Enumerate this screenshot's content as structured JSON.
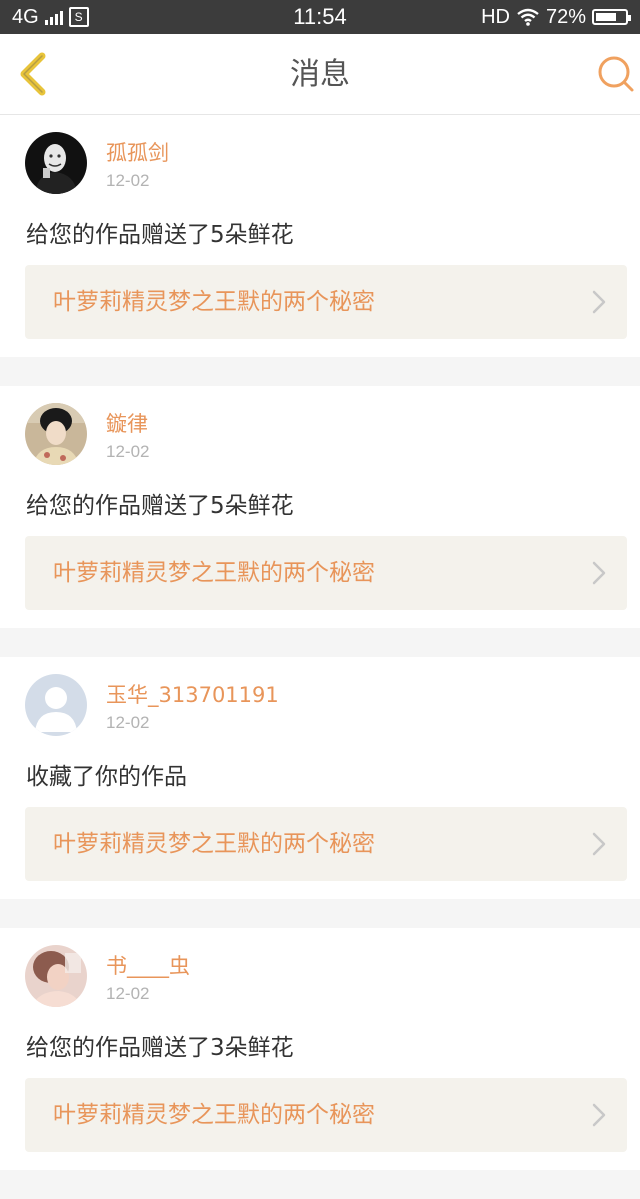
{
  "status_bar": {
    "network": "4G",
    "sim_label": "S",
    "time": "11:54",
    "hd": "HD",
    "battery": "72%",
    "battery_level": 0.72
  },
  "header": {
    "title": "消息",
    "back_icon": "chevron-left-icon",
    "search_icon": "search-icon",
    "accent_color": "#f0a15f",
    "back_color": "#e8c43a"
  },
  "messages": [
    {
      "username": "孤孤剑",
      "date": "12-02",
      "text": "给您的作品赠送了5朵鲜花",
      "work_title": "叶萝莉精灵梦之王默的两个秘密"
    },
    {
      "username": "鏇律",
      "date": "12-02",
      "text": "给您的作品赠送了5朵鲜花",
      "work_title": "叶萝莉精灵梦之王默的两个秘密"
    },
    {
      "username": "玉华_313701191",
      "date": "12-02",
      "text": "收藏了你的作品",
      "work_title": "叶萝莉精灵梦之王默的两个秘密"
    },
    {
      "username": "书____虫",
      "date": "12-02",
      "text": "给您的作品赠送了3朵鲜花",
      "work_title": "叶萝莉精灵梦之王默的两个秘密"
    }
  ]
}
